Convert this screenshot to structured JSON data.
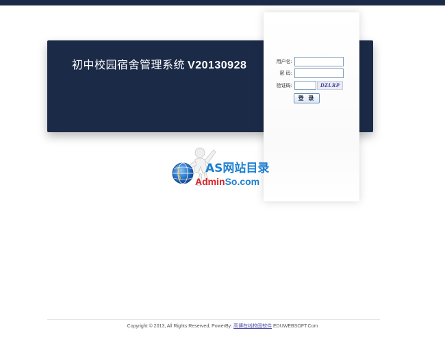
{
  "banner": {
    "title_cn": "初中校园宿舍管理系统",
    "title_version": "V20130928"
  },
  "login": {
    "username_label": "用户名:",
    "password_label": "密 码:",
    "captcha_label": "验证码:",
    "captcha_text": "DZLRP",
    "submit_label": "登 录",
    "username_value": "",
    "password_value": "",
    "captcha_value": ""
  },
  "watermark": {
    "text_top": "AS网站目录",
    "text_bottom_red": "Admin",
    "text_bottom_blue": "So.com",
    "icon": "person-with-globe-icon"
  },
  "footer": {
    "prefix": "Copyright © 2013, All Rights Reserved, PowerBy:",
    "link_text": "高博在线校园软件",
    "suffix": "EDUWEBSOFT.Com"
  },
  "colors": {
    "navy": "#1b2a47",
    "link": "#4a4aa8",
    "logo_blue": "#1c7fd0",
    "logo_red": "#d8232a"
  }
}
